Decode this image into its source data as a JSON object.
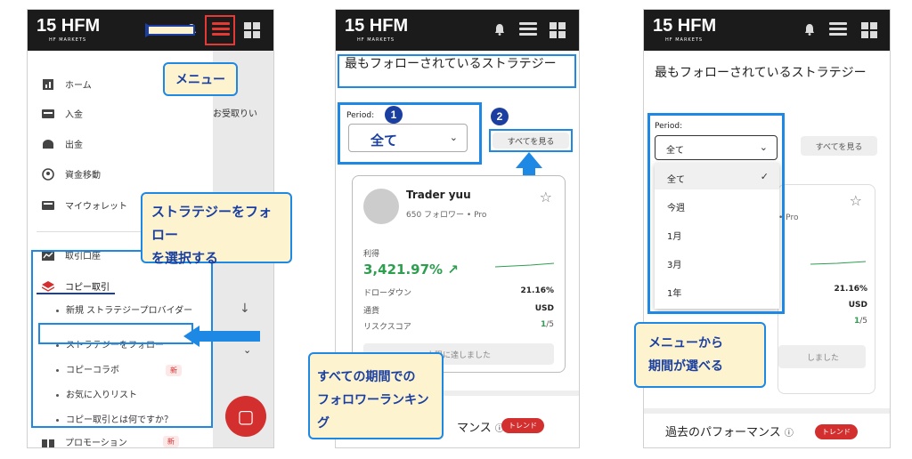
{
  "brand": {
    "logo_main": "15 HFM",
    "logo_sub": "HF MARKETS"
  },
  "panel1": {
    "menu_items": [
      {
        "label": "ホーム",
        "icon": "bar-chart-icon"
      },
      {
        "label": "入金",
        "icon": "deposit-icon"
      },
      {
        "label": "出金",
        "icon": "withdraw-icon"
      },
      {
        "label": "資金移動",
        "icon": "transfer-icon"
      },
      {
        "label": "マイウォレット",
        "icon": "wallet-icon"
      }
    ],
    "trade_account": "取引口座",
    "copy_trade": "コピー取引",
    "sub_items": [
      "新規 ストラテジープロバイダー",
      "ストラテジーをフォロー",
      "コピーコラボ",
      "お気に入りリスト",
      "コピー取引とは何ですか？"
    ],
    "new_badge": "新",
    "promotion": "プロモーション",
    "backdrop_text": "お受取りい",
    "callout_menu": "メニュー",
    "callout_follow": "ストラテジーをフォロー\nを選択する"
  },
  "panel2": {
    "title": "最もフォローされているストラテジー",
    "period_label": "Period:",
    "period_value": "全て",
    "see_all": "すべてを見る",
    "trader_name": "Trader yuu",
    "trader_meta": "650 フォロワー • Pro",
    "profit_label": "利得",
    "profit_value": "3,421.97%",
    "drawdown_label": "ドローダウン",
    "drawdown_value": "21.16%",
    "currency_label": "通貨",
    "currency_value": "USD",
    "risk_label": "リスクスコア",
    "risk_value": "1",
    "risk_max": "/5",
    "limit_btn": "上限に達しました",
    "past_perf": "マンス",
    "trend": "トレンド",
    "callout": "すべての期間での\nフォロワーランキング",
    "n1": "1",
    "n2": "2"
  },
  "panel3": {
    "title": "最もフォローされているストラテジー",
    "period_label": "Period:",
    "period_value": "全て",
    "see_all": "すべてを見る",
    "options": [
      "全て",
      "今週",
      "1月",
      "3月",
      "1年"
    ],
    "meta_partial": "• Pro",
    "drawdown_value": "21.16%",
    "currency_value": "USD",
    "risk_value": "1",
    "risk_max": "/5",
    "limit_partial": "しました",
    "past_perf": "過去のパフォーマンス",
    "trend": "トレンド",
    "callout": "メニューから\n期間が選べる"
  },
  "colors": {
    "accent_blue": "#1e88e5",
    "brand_red": "#d32f2f",
    "profit_green": "#2e9e4f",
    "callout_bg": "#fdf4cf"
  }
}
